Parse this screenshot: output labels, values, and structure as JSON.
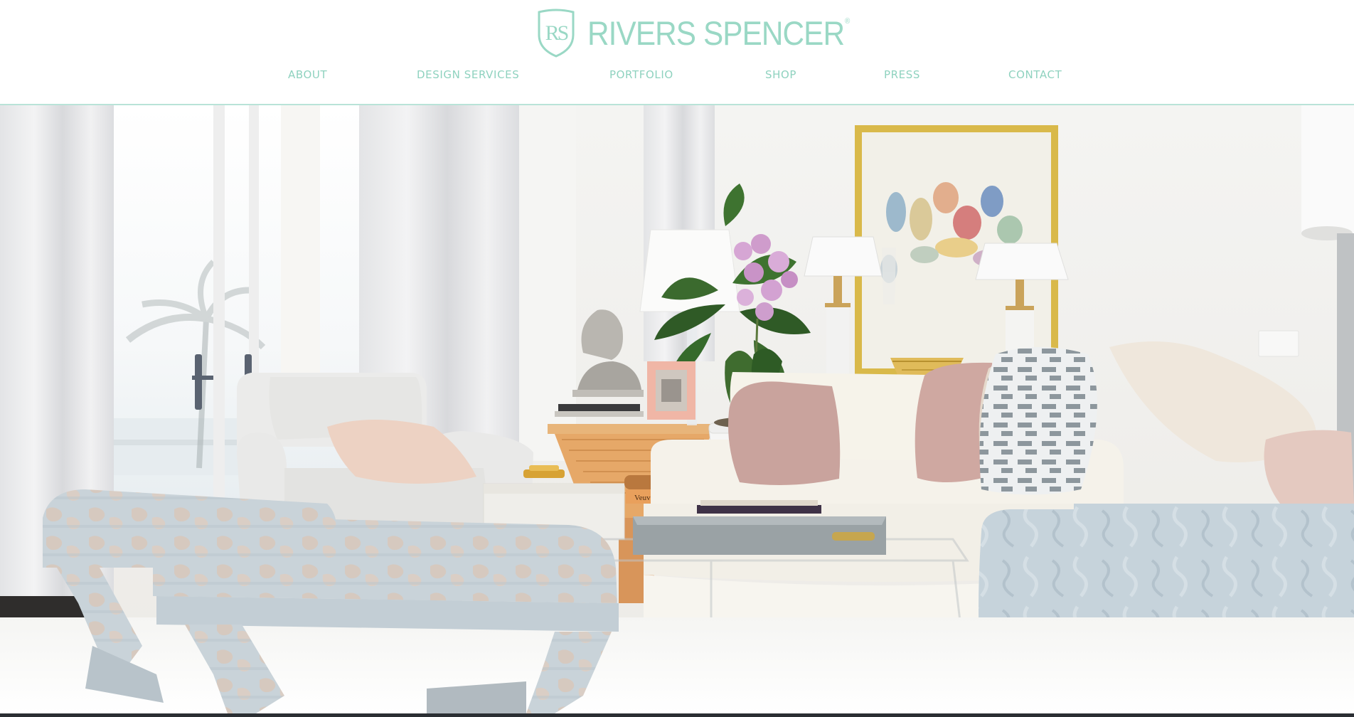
{
  "brand": {
    "monogram": "RS",
    "name": "RIVERS SPENCER",
    "registered": "®",
    "color": "#9ad8c5"
  },
  "nav": {
    "items": [
      {
        "label": "ABOUT"
      },
      {
        "label": "DESIGN SERVICES"
      },
      {
        "label": "PORTFOLIO"
      },
      {
        "label": "SHOP"
      },
      {
        "label": "PRESS"
      },
      {
        "label": "CONTACT"
      }
    ],
    "color": "#8fd2bf"
  },
  "hero": {
    "subject": "living-room-interior-photo",
    "book_spine_text": "Veuve Clicquot"
  },
  "colors": {
    "accent": "#9ad8c5",
    "header_border": "#b9e3d8",
    "background": "#ffffff"
  }
}
